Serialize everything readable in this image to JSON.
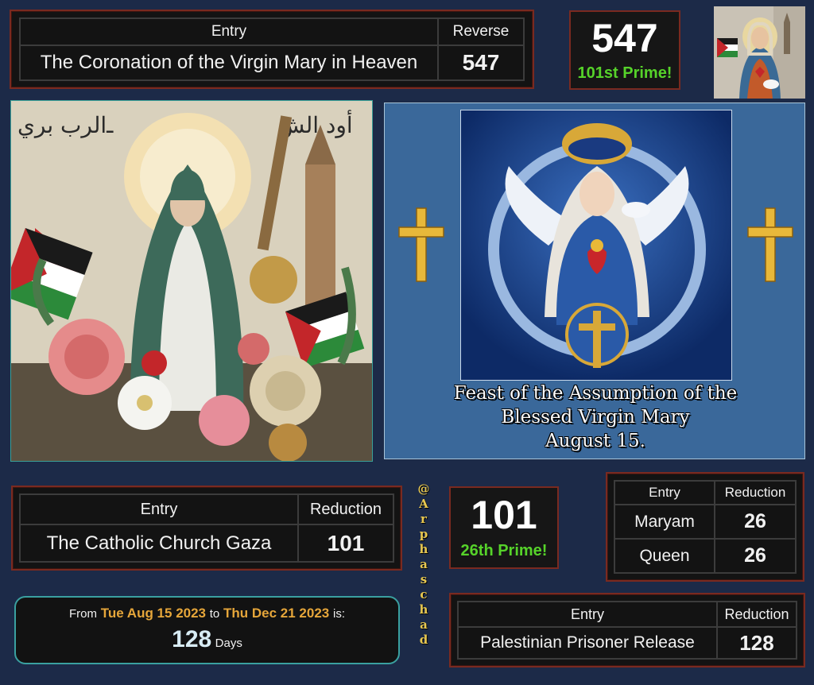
{
  "top_table": {
    "entry_header": "Entry",
    "cipher_header": "Reverse",
    "entry": "The Coronation of the Virgin Mary in Heaven",
    "value": "547"
  },
  "top_prime": {
    "number": "547",
    "label": "101st Prime!"
  },
  "caption": {
    "line1": "Feast of the Assumption of the",
    "line2": "Blessed Virgin Mary",
    "line3": "August 15."
  },
  "mid_table": {
    "entry_header": "Entry",
    "cipher_header": "Reduction",
    "entry": "The Catholic Church Gaza",
    "value": "101"
  },
  "handle": "@Arphaschad",
  "mid_prime": {
    "number": "101",
    "label": "26th Prime!"
  },
  "right_table": {
    "entry_header": "Entry",
    "cipher_header": "Reduction",
    "rows": [
      {
        "entry": "Maryam",
        "value": "26"
      },
      {
        "entry": "Queen",
        "value": "26"
      }
    ]
  },
  "date_box": {
    "from_word": "From",
    "start": "Tue Aug 15 2023",
    "to_word": "to",
    "end": "Thu Dec 21 2023",
    "is_word": "is:",
    "days": "128",
    "days_word": "Days"
  },
  "bottom_table": {
    "entry_header": "Entry",
    "cipher_header": "Reduction",
    "entry": "Palestinian Prisoner Release",
    "value": "128"
  },
  "colors": {
    "background": "#1c2a48",
    "border": "#7a2a20",
    "green": "#56d32a",
    "orange": "#e6a64a",
    "blue": "#7e88f4"
  }
}
